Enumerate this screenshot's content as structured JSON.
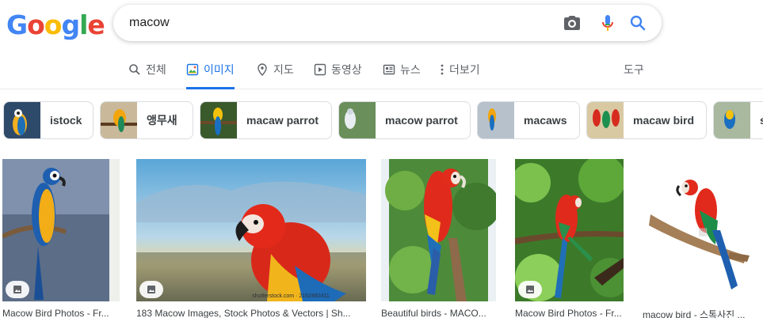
{
  "logo": {
    "letters": [
      "G",
      "o",
      "o",
      "g",
      "l",
      "e"
    ],
    "colors": [
      "#4285F4",
      "#EA4335",
      "#FBBC05",
      "#4285F4",
      "#34A853",
      "#EA4335"
    ]
  },
  "search": {
    "query": "macow",
    "camera_icon": "camera-icon",
    "mic_icon": "mic-icon",
    "search_icon": "search-icon"
  },
  "tabs": [
    {
      "label": "전체",
      "icon": "search-icon"
    },
    {
      "label": "이미지",
      "icon": "image-icon",
      "active": true
    },
    {
      "label": "지도",
      "icon": "map-pin-icon"
    },
    {
      "label": "동영상",
      "icon": "play-icon"
    },
    {
      "label": "뉴스",
      "icon": "news-icon"
    },
    {
      "label": "더보기",
      "icon": "more-vert-icon"
    },
    {
      "label": "도구"
    }
  ],
  "chips": [
    {
      "label": "istock"
    },
    {
      "label": "앵무새"
    },
    {
      "label": "macaw parrot"
    },
    {
      "label": "macow parrot"
    },
    {
      "label": "macaws"
    },
    {
      "label": "macaw bird"
    },
    {
      "label": "s"
    }
  ],
  "results": [
    {
      "caption": "Macow Bird Photos - Fr..."
    },
    {
      "caption": "183 Macow Images, Stock Photos & Vectors | Sh...",
      "watermark": "shutterstock.com · 2152492411"
    },
    {
      "caption": "Beautiful birds - MACO..."
    },
    {
      "caption": "Macow Bird Photos - Fr..."
    },
    {
      "caption": "macow bird - 스톡사진 ..."
    }
  ],
  "colors": {
    "accent": "#1a73e8",
    "text_muted": "#5f6368",
    "chip_border": "#dadce0"
  }
}
